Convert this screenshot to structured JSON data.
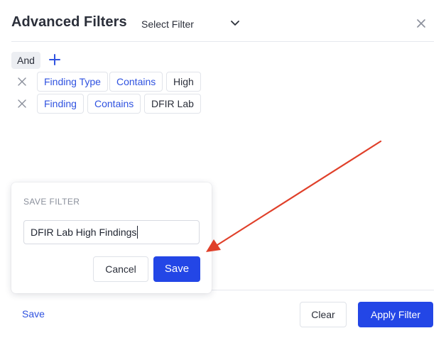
{
  "header": {
    "title": "Advanced Filters",
    "select_filter_label": "Select Filter"
  },
  "conditions": {
    "logic_operator": "And",
    "rows": [
      {
        "field": "Finding Type",
        "operator": "Contains",
        "value": "High"
      },
      {
        "field": "Finding",
        "operator": "Contains",
        "value": "DFIR Lab"
      }
    ]
  },
  "save_filter_panel": {
    "title": "SAVE FILTER",
    "name_value": "DFIR Lab High Findings",
    "cancel_label": "Cancel",
    "save_label": "Save"
  },
  "footer": {
    "save_link": "Save",
    "clear_label": "Clear",
    "apply_label": "Apply Filter"
  },
  "colors": {
    "accent": "#2346e6",
    "link_blue": "#2f52e0",
    "annotation_arrow": "#e0402a"
  },
  "icons": {
    "select_chevron": "chevron-down-icon",
    "close": "close-icon",
    "add": "plus-icon",
    "remove_row": "remove-icon"
  }
}
